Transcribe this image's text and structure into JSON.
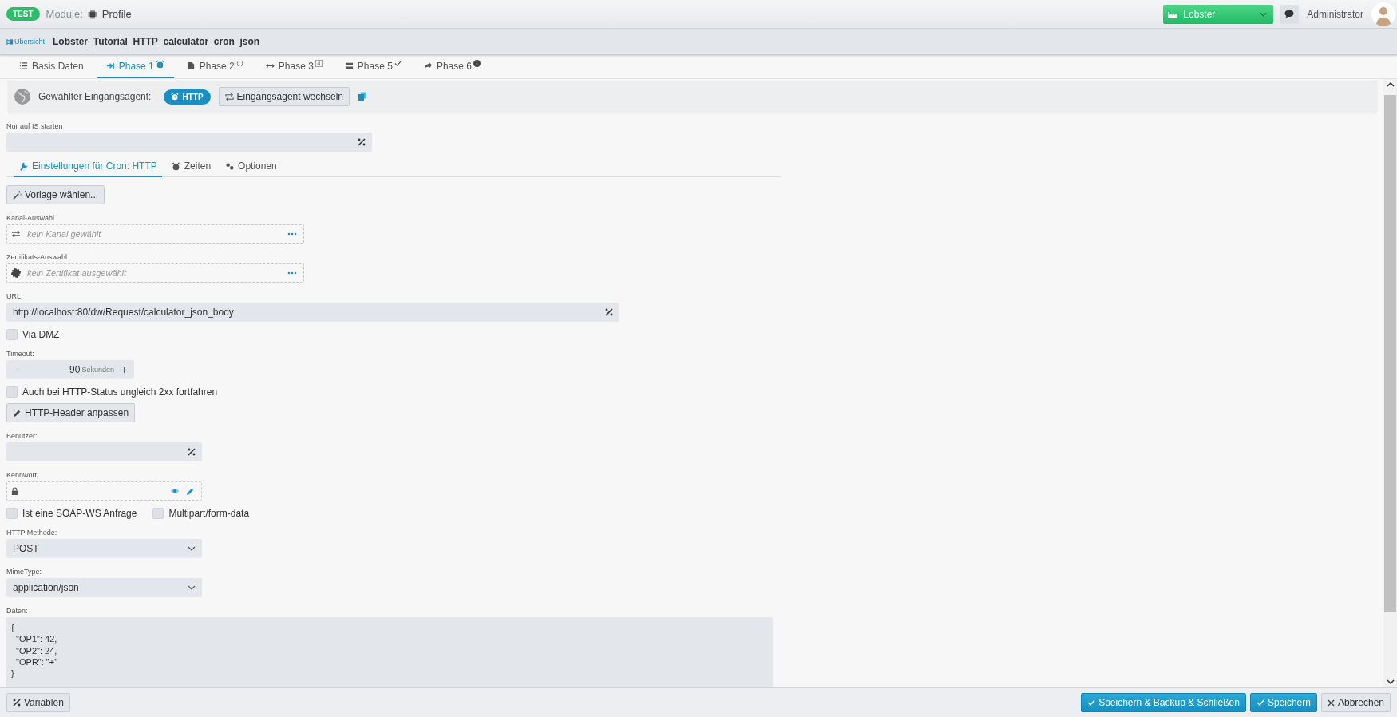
{
  "header": {
    "badge": "TEST",
    "module_label": "Module:",
    "module_name": "Profile",
    "tenant": "Lobster",
    "user": "Administrator"
  },
  "breadcrumb": {
    "link": "Übersicht",
    "title": "Lobster_Tutorial_HTTP_calculator_cron_json"
  },
  "tabs": [
    {
      "label": "Basis Daten",
      "selected": false
    },
    {
      "label": "Phase 1",
      "selected": true
    },
    {
      "label": "Phase 2",
      "selected": false
    },
    {
      "label": "Phase 3",
      "selected": false
    },
    {
      "label": "Phase 5",
      "selected": false
    },
    {
      "label": "Phase 6",
      "selected": false
    }
  ],
  "agent": {
    "label": "Gewählter Eingangsagent:",
    "chip": "HTTP",
    "switch_button": "Eingangsagent wechseln"
  },
  "is_start": {
    "label": "Nur auf IS starten"
  },
  "subtabs": [
    {
      "label": "Einstellungen für Cron: HTTP",
      "selected": true
    },
    {
      "label": "Zeiten",
      "selected": false
    },
    {
      "label": "Optionen",
      "selected": false
    }
  ],
  "template_button": "Vorlage wählen...",
  "channel": {
    "label": "Kanal-Auswahl",
    "placeholder": "kein Kanal gewählt"
  },
  "certificate": {
    "label": "Zertifikats-Auswahl",
    "placeholder": "kein Zertifikat ausgewählt"
  },
  "url": {
    "label": "URL",
    "value": "http://localhost:80/dw/Request/calculator_json_body"
  },
  "via_dmz": {
    "label": "Via DMZ",
    "checked": false
  },
  "timeout": {
    "label": "Timeout:",
    "value": "90",
    "unit": "Sekunden"
  },
  "continue_on_status": {
    "label": "Auch bei HTTP-Status ungleich 2xx fortfahren",
    "checked": false
  },
  "header_button": "HTTP-Header anpassen",
  "user": {
    "label": "Benutzer:"
  },
  "password": {
    "label": "Kennwort:"
  },
  "options": [
    {
      "label": "Ist eine SOAP-WS Anfrage",
      "checked": false
    },
    {
      "label": "Multipart/form-data",
      "checked": false
    }
  ],
  "method": {
    "label": "HTTP Methode:",
    "value": "POST"
  },
  "mime": {
    "label": "MimeType:",
    "value": "application/json"
  },
  "data": {
    "label": "Daten:",
    "value": "{\n  \"OP1\": 42,\n  \"OP2\": 24,\n  \"OPR\": \"+\"\n}"
  },
  "footer": {
    "variables_button": "Variablen",
    "buttons": [
      {
        "label": "Speichern & Backup & Schließen",
        "kind": "primary"
      },
      {
        "label": "Speichern",
        "kind": "primary"
      },
      {
        "label": "Abbrechen",
        "kind": "secondary"
      }
    ]
  }
}
